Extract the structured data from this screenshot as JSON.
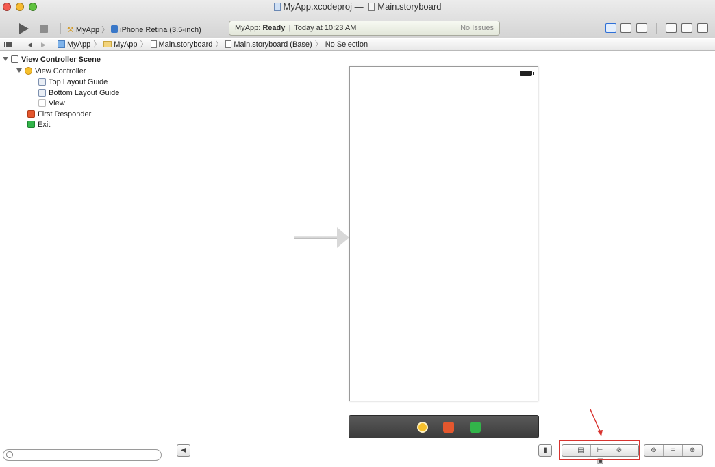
{
  "window": {
    "title_project": "MyApp.xcodeproj",
    "title_dash": "—",
    "title_file": "Main.storyboard"
  },
  "toolbar": {
    "scheme_app": "MyApp",
    "scheme_device": "iPhone Retina (3.5-inch)",
    "status_app": "MyApp:",
    "status_state": "Ready",
    "status_time": "Today at 10:23 AM",
    "status_issues": "No Issues"
  },
  "jumpbar": {
    "path": [
      "MyApp",
      "MyApp",
      "Main.storyboard",
      "Main.storyboard (Base)",
      "No Selection"
    ]
  },
  "outline": {
    "items": [
      {
        "label": "View Controller Scene",
        "icon": "scene-icon"
      },
      {
        "label": "View Controller",
        "icon": "view-controller-icon"
      },
      {
        "label": "Top Layout Guide",
        "icon": "layout-guide-icon"
      },
      {
        "label": "Bottom Layout Guide",
        "icon": "layout-guide-icon"
      },
      {
        "label": "View",
        "icon": "view-icon"
      },
      {
        "label": "First Responder",
        "icon": "first-responder-icon"
      },
      {
        "label": "Exit",
        "icon": "exit-icon"
      }
    ]
  },
  "bottom_bar": {
    "autolayout_groups": [
      "align",
      "pin",
      "resolve",
      "resizing"
    ],
    "zoom_groups": [
      "zoom-out",
      "zoom-actual",
      "zoom-in"
    ]
  },
  "colors": {
    "highlight": "#d8332f",
    "accent": "#2e6fd6",
    "exit_green": "#32b44a",
    "responder_orange": "#e4572e",
    "vc_yellow": "#f6c02c"
  }
}
